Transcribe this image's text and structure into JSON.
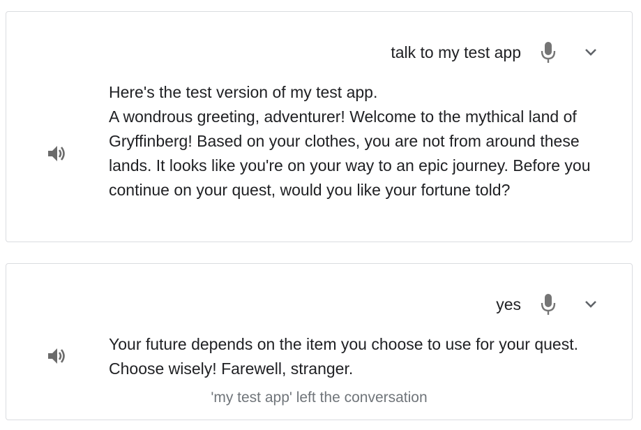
{
  "conversation": [
    {
      "query": "talk to my test app",
      "response_lines": [
        "Here's the test version of my test app.",
        "A wondrous greeting, adventurer! Welcome to the mythical land of Gryffinberg! Based on your clothes, you are not from around these lands. It looks like you're on your way to an epic journey. Before you continue on your quest, would you like your fortune told?"
      ]
    },
    {
      "query": "yes",
      "response_lines": [
        "Your future depends on the item you choose to use for your quest. Choose wisely! Farewell, stranger."
      ],
      "status_note": "'my test app' left the conversation"
    }
  ],
  "icons": {
    "mic": "mic-icon",
    "expand": "chevron-down-icon",
    "speaker": "speaker-icon"
  },
  "colors": {
    "text": "#202124",
    "icon": "#757575",
    "muted": "#70757a",
    "border": "#dadce0"
  }
}
